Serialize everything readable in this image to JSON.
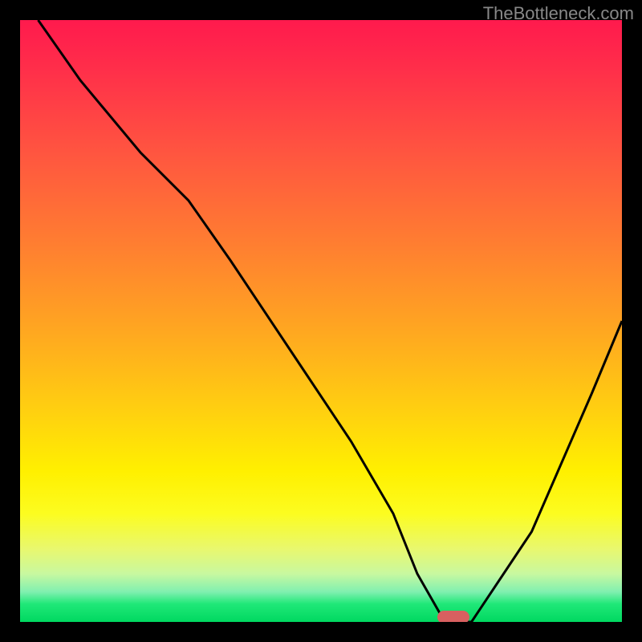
{
  "watermark": "TheBottleneck.com",
  "chart_data": {
    "type": "line",
    "title": "",
    "xlabel": "",
    "ylabel": "",
    "xlim": [
      0,
      100
    ],
    "ylim": [
      0,
      100
    ],
    "grid": false,
    "series": [
      {
        "name": "bottleneck-curve",
        "x": [
          3,
          10,
          20,
          28,
          35,
          45,
          55,
          62,
          66,
          70,
          72,
          75,
          85,
          95,
          100
        ],
        "y": [
          100,
          90,
          78,
          70,
          60,
          45,
          30,
          18,
          8,
          1,
          0,
          0,
          15,
          38,
          50
        ]
      }
    ],
    "annotations": [
      {
        "name": "optimal-marker",
        "x": 72,
        "y": 0,
        "color": "#d86060"
      }
    ],
    "background_gradient": {
      "top_color": "#ff1a4d",
      "bottom_color": "#00d860",
      "description": "rainbow gradient red-orange-yellow-green representing bottleneck severity"
    }
  }
}
